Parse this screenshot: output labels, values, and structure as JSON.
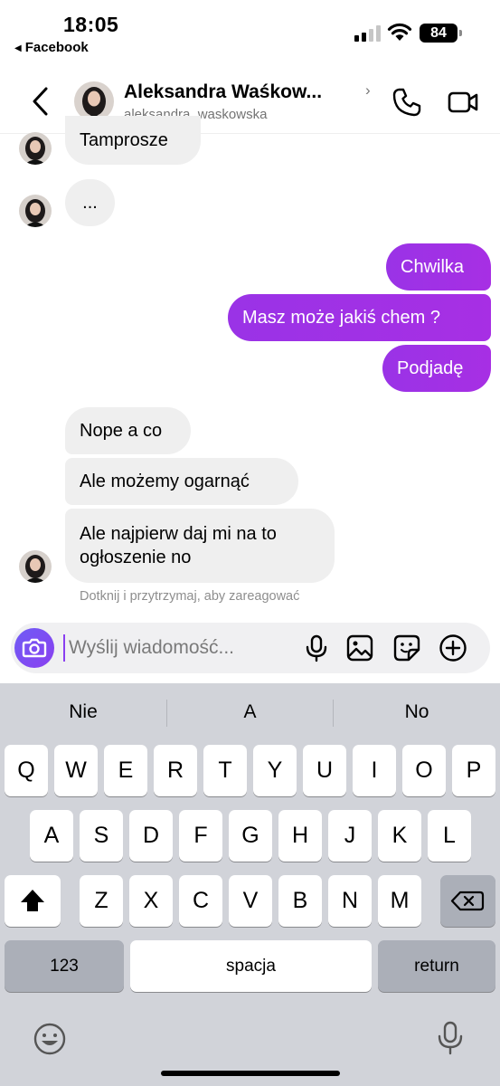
{
  "status_bar": {
    "time": "18:05",
    "back_app": "Facebook",
    "battery": "84"
  },
  "header": {
    "name": "Aleksandra Waśkow...",
    "username": "aleksandra_waskowska",
    "chevron": "›",
    "icons": [
      "back-chevron-icon",
      "phone-icon",
      "video-camera-icon"
    ]
  },
  "messages": [
    {
      "direction": "in",
      "text": "Tamprosze"
    },
    {
      "direction": "in",
      "text": "..."
    },
    {
      "direction": "out",
      "text": "Chwilka"
    },
    {
      "direction": "out",
      "text": "Masz może jakiś chem ?"
    },
    {
      "direction": "out",
      "text": "Podjadę"
    },
    {
      "direction": "in",
      "text": "Nope a co"
    },
    {
      "direction": "in",
      "text": "Ale możemy ogarnąć"
    },
    {
      "direction": "in",
      "text_lines": [
        "Ale najpierw daj mi na to",
        "ogłoszenie no"
      ]
    }
  ],
  "hint": "Dotknij i przytrzymaj, aby zareagować",
  "composer": {
    "placeholder": "Wyślij wiadomość...",
    "icons": [
      "camera-icon",
      "microphone-icon",
      "gallery-icon",
      "sticker-icon",
      "plus-icon"
    ]
  },
  "keyboard": {
    "suggestions": [
      "Nie",
      "A",
      "No"
    ],
    "row1": [
      "Q",
      "W",
      "E",
      "R",
      "T",
      "Y",
      "U",
      "I",
      "O",
      "P"
    ],
    "row2": [
      "A",
      "S",
      "D",
      "F",
      "G",
      "H",
      "J",
      "K",
      "L"
    ],
    "row3": [
      "Z",
      "X",
      "C",
      "V",
      "B",
      "N",
      "M"
    ],
    "numbers_key": "123",
    "space_key": "spacja",
    "return_key": "return"
  },
  "colors": {
    "outgoing_bubble": "#a030e6",
    "incoming_bubble": "#efefef",
    "camera_button": "#6a47f2",
    "keyboard_bg": "#d1d3d9"
  }
}
